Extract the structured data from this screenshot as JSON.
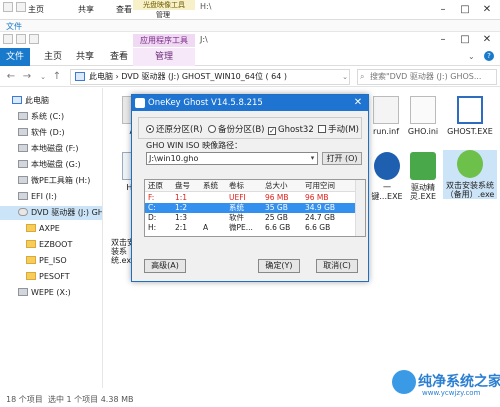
{
  "bg_window": {
    "tabs": [
      "文件",
      "主页",
      "共享",
      "查看"
    ],
    "context_tab": "光盘映像工具",
    "context_sub": "管理",
    "path": "H:\\"
  },
  "front_window": {
    "context_tab": "应用程序工具",
    "path": "J:\\",
    "ribbon_tabs": [
      "文件",
      "主页",
      "共享",
      "查看",
      "管理"
    ]
  },
  "address": {
    "crumbs": "此电脑 › DVD 驱动器 (J:) GHOST_WIN10_64位 ( 64 )",
    "search_placeholder": "搜索\"DVD 驱动器 (J:) GHOS..."
  },
  "sidebar": {
    "items": [
      {
        "label": "此电脑",
        "icon": "pc-icon"
      },
      {
        "label": "系统 (C:)",
        "icon": "drive-icon"
      },
      {
        "label": "软件 (D:)",
        "icon": "drive-icon"
      },
      {
        "label": "本地磁盘 (F:)",
        "icon": "drive-icon"
      },
      {
        "label": "本地磁盘 (G:)",
        "icon": "drive-icon"
      },
      {
        "label": "微PE工具箱 (H:)",
        "icon": "drive-icon"
      },
      {
        "label": "EFI (I:)",
        "icon": "drive-icon"
      },
      {
        "label": "DVD 驱动器 (J:) GH",
        "icon": "dvd-icon"
      },
      {
        "label": "AXPE",
        "icon": "folder-icon"
      },
      {
        "label": "EZBOOT",
        "icon": "folder-icon"
      },
      {
        "label": "PE_ISO",
        "icon": "folder-icon"
      },
      {
        "label": "PESOFT",
        "icon": "folder-icon"
      },
      {
        "label": "WEPE (X:)",
        "icon": "drive-icon"
      }
    ]
  },
  "files": [
    {
      "label": "AX"
    },
    {
      "label": "HD4"
    },
    {
      "label": "双击安装系统.exe"
    },
    {
      "label": "run.inf"
    },
    {
      "label": "GHO.ini"
    },
    {
      "label": "GHOST.EXE"
    },
    {
      "label": "一键...EXE"
    },
    {
      "label": "驱动精灵.EXE"
    },
    {
      "label": "双击安装系统（备用）.exe"
    }
  ],
  "status": {
    "items": "18 个项目",
    "selected": "选中 1 个项目  4.38 MB"
  },
  "dialog": {
    "title": "OneKey Ghost V14.5.8.215",
    "options": [
      {
        "label": "还原分区(R)",
        "checked": true
      },
      {
        "label": "备份分区(B)",
        "checked": false
      },
      {
        "label": "Ghost32",
        "checked": true
      },
      {
        "label": "手动(M)",
        "checked": false
      }
    ],
    "path_label": "GHO WIN ISO 映像路径：",
    "path_value": "J:\\win10.gho",
    "open_label": "打开 (O)",
    "table": {
      "headers": [
        "还原",
        "盘号",
        "系统",
        "卷标",
        "总大小",
        "可用空间"
      ],
      "rows": [
        {
          "restore": "F:",
          "disk": "1:1",
          "sys": "",
          "label": "UEFI",
          "total": "96 MB",
          "free": "96 MB",
          "style": "red"
        },
        {
          "restore": "C:",
          "disk": "1:2",
          "sys": "",
          "label": "系统",
          "total": "35 GB",
          "free": "34.9 GB",
          "style": "sel"
        },
        {
          "restore": "D:",
          "disk": "1:3",
          "sys": "",
          "label": "软件",
          "total": "25 GB",
          "free": "24.7 GB",
          "style": ""
        },
        {
          "restore": "H:",
          "disk": "2:1",
          "sys": "A",
          "label": "微PE...",
          "total": "6.6 GB",
          "free": "6.6 GB",
          "style": ""
        }
      ]
    },
    "buttons": {
      "advanced": "高级(A)",
      "ok": "确定(Y)",
      "cancel": "取消(C)"
    }
  },
  "watermark": {
    "text": "纯净系统之家",
    "url": "www.ycwjzy.com"
  }
}
